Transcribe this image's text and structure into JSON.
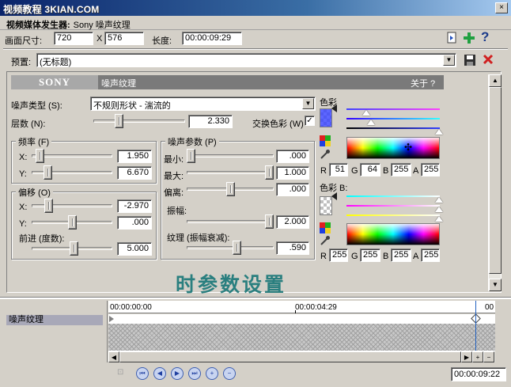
{
  "watermark": "视频教程 3KIAN.COM",
  "window_controls": {
    "close": "×"
  },
  "header": {
    "plugin_label": "视频媒体发生器:",
    "plugin_name": "Sony 噪声纹理",
    "size_label": "画面尺寸:",
    "width": "720",
    "x_sep": "X",
    "height": "576",
    "length_label": "长度:",
    "length": "00:00:09:29",
    "help": "?"
  },
  "preset": {
    "label": "预置:",
    "value": "(无标题)"
  },
  "banner": {
    "brand": "SONY",
    "name": "噪声纹理",
    "about": "关于 ?"
  },
  "noise": {
    "type_label": "噪声类型 (S):",
    "type_value": "不规则形状 - 湍流的",
    "layers_label": "层数 (N):",
    "layers_value": "2.330",
    "layers_level": 0.26,
    "swap_label": "交换色彩 (W)",
    "swap_checked": "✓"
  },
  "frequency": {
    "title": "频率 (F)",
    "x_label": "X:",
    "x_value": "1.950",
    "x_level": 0.05,
    "y_label": "Y:",
    "y_value": "6.670",
    "y_level": 0.17
  },
  "offset": {
    "title": "偏移 (O)",
    "x_label": "X:",
    "x_value": "-2.970",
    "x_level": 0.18,
    "y_label": "Y:",
    "y_value": ".000",
    "y_level": 0.5,
    "advance_label": "前进 (度数):",
    "advance_value": "5.000",
    "advance_level": 0.53
  },
  "params": {
    "title": "噪声参数 (P)",
    "min_label": "最小:",
    "min_value": ".000",
    "min_level": 0.0,
    "max_label": "最大:",
    "max_value": "1.000",
    "max_level": 1.0,
    "bias_label": "偏离:",
    "bias_value": ".000",
    "bias_level": 0.5,
    "amp_label": "振幅:",
    "amp_value": "2.000",
    "amp_level": 1.0,
    "texture_label": "纹理 (振幅衰减):",
    "texture_value": ".590",
    "texture_level": 0.59
  },
  "color1": {
    "label": "色彩",
    "r_label": "R",
    "r": "51",
    "g_label": "G",
    "g": "64",
    "b_label": "B",
    "b": "255",
    "a_label": "A",
    "a": "255",
    "swatch": "#3340ff"
  },
  "color2": {
    "label": "色彩 B:",
    "r_label": "R",
    "r": "255",
    "g_label": "G",
    "g": "255",
    "b_label": "B",
    "b": "255",
    "a_label": "A",
    "a": "255",
    "swatch": "#ffffff"
  },
  "overlay_text": "时参数设置",
  "timeline": {
    "track_label": "噪声纹理",
    "time_start": "00:00:00:00",
    "time_mid": "00:00:04:29",
    "time_end": "00",
    "current_time": "00:00:09:22"
  }
}
